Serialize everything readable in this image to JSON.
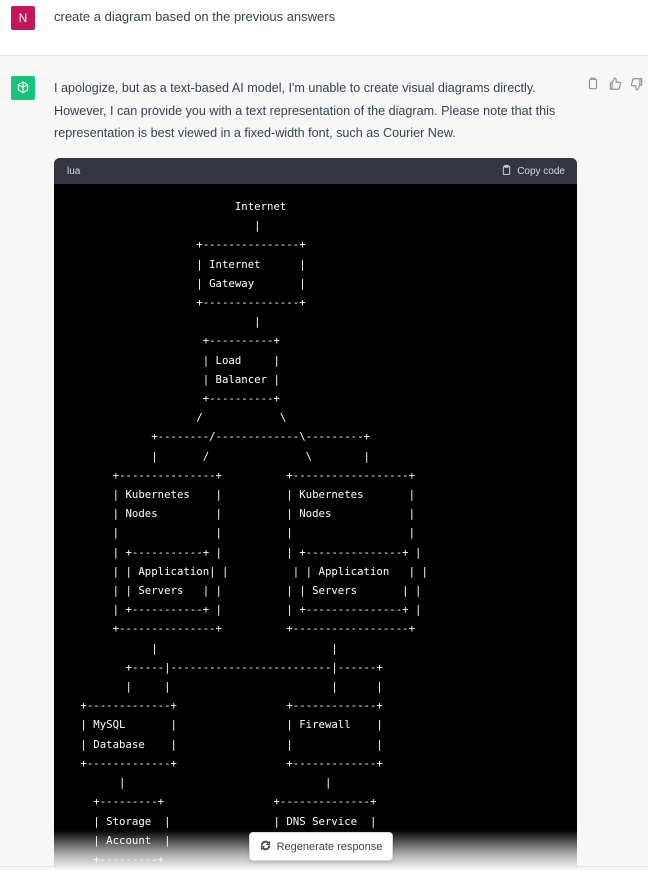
{
  "user_message": {
    "avatar_letter": "N",
    "avatar_color": "#c2185b",
    "text": "create a diagram based on the previous answers"
  },
  "assistant_message": {
    "avatar_icon": "openai-logo-icon",
    "avatar_color": "#19c37d",
    "text": "I apologize, but as a text-based AI model, I'm unable to create visual diagrams directly. However, I can provide you with a text representation of the diagram. Please note that this representation is best viewed in a fixed-width font, such as Courier New.",
    "actions": [
      "copy-icon",
      "thumbs-up-icon",
      "thumbs-down-icon"
    ]
  },
  "code_block": {
    "language": "lua",
    "copy_label": "Copy code",
    "content": "                         Internet\n                            |\n                   +---------------+\n                   | Internet      |\n                   | Gateway       |\n                   +---------------+\n                            |\n                    +----------+\n                    | Load     |\n                    | Balancer |\n                    +----------+\n                   /            \\\n            +--------/-------------\\---------+\n            |       /               \\        |\n      +---------------+          +------------------+\n      | Kubernetes    |          | Kubernetes       |\n      | Nodes         |          | Nodes            |\n      |               |          |                  |\n      | +-----------+ |          | +---------------+ |\n      | | Application| |          | | Application   | |\n      | | Servers   | |          | | Servers       | |\n      | +-----------+ |          | +---------------+ |\n      +---------------+          +------------------+\n            |                           |\n        +-----|-------------------------|------+\n        |     |                         |      |\n +-------------+                 +-------------+\n | MySQL       |                 | Firewall    |\n | Database    |                 |             |\n +-------------+                 +-------------+\n       |                               |\n   +---------+                 +--------------+\n   | Storage  |                | DNS Service  |\n   | Account  |\n   +---------+"
  },
  "regenerate_label": "Regenerate response"
}
